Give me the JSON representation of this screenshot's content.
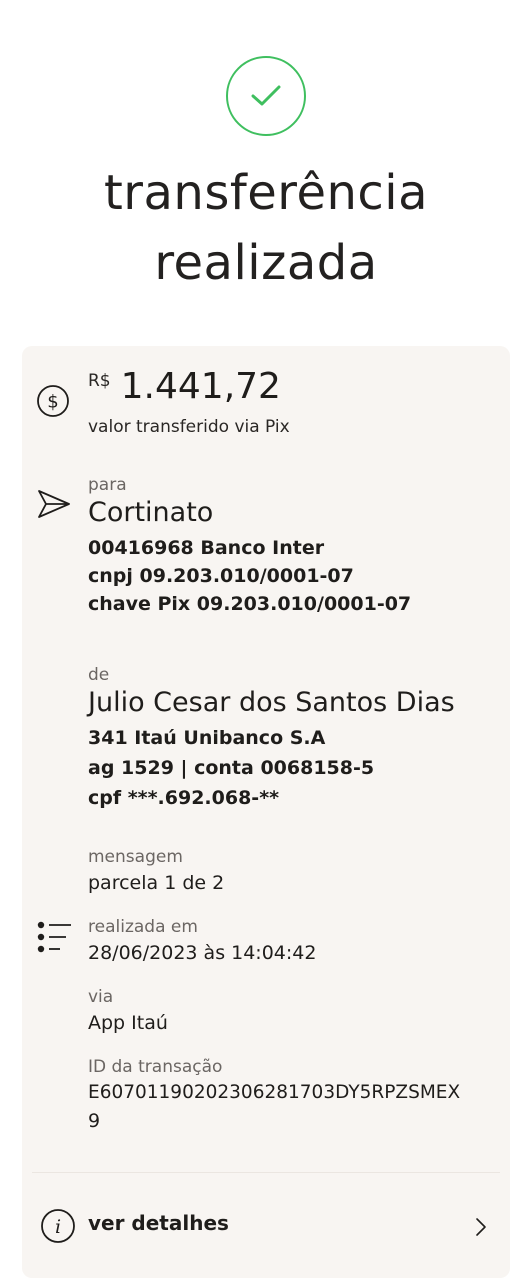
{
  "header": {
    "title_line1": "transferência",
    "title_line2": "realizada"
  },
  "amount": {
    "currency": "R$",
    "value": "1.441,72",
    "caption": "valor transferido via Pix"
  },
  "recipient": {
    "label": "para",
    "name": "Cortinato",
    "bank": "00416968 Banco Inter",
    "cnpj": "cnpj 09.203.010/0001-07",
    "pix_key": "chave Pix 09.203.010/0001-07"
  },
  "sender": {
    "label": "de",
    "name": "Julio Cesar dos Santos Dias",
    "bank": "341 Itaú Unibanco S.A",
    "account": "ag 1529 | conta 0068158-5",
    "cpf": "cpf ***.692.068-**"
  },
  "message": {
    "label": "mensagem",
    "value": "parcela 1 de 2"
  },
  "datetime": {
    "label": "realizada em",
    "value": "28/06/2023 às 14:04:42"
  },
  "channel": {
    "label": "via",
    "value": "App Itaú"
  },
  "transaction": {
    "label": "ID da transação",
    "value_line1": "E60701190202306281703DY5RPZSMEX",
    "value_line2": "9"
  },
  "details": {
    "label": "ver detalhes"
  },
  "colors": {
    "success": "#3fbf5f",
    "card_bg": "#f8f5f2",
    "text": "#1f1d1b",
    "muted": "#6b6663"
  }
}
